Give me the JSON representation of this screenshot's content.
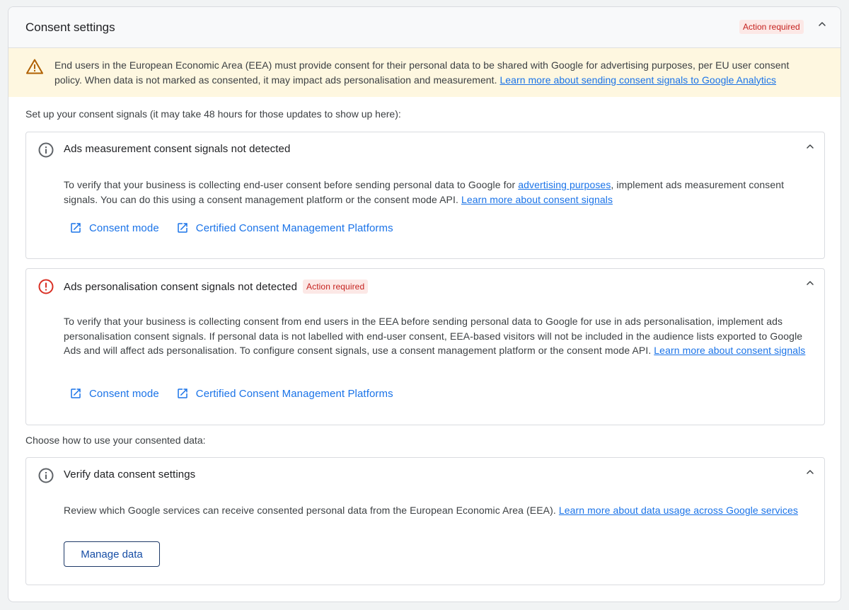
{
  "card": {
    "title": "Consent settings",
    "status_badge": "Action required"
  },
  "warning": {
    "text": "End users in the European Economic Area (EEA) must provide consent for their personal data to be shared with Google for advertising purposes, per EU user consent policy. When data is not marked as consented, it may impact ads personalisation and measurement. ",
    "link": "Learn more about sending consent signals to Google Analytics"
  },
  "setup_label": "Set up your consent signals (it may take 48 hours for those updates to show up here):",
  "measurement_panel": {
    "title": "Ads measurement consent signals not detected",
    "body_1": "To verify that your business is collecting end-user consent before sending personal data to Google for ",
    "body_link_1": "advertising purposes",
    "body_2": ", implement ads measurement consent signals. You can do this using a consent management platform or the consent mode API. ",
    "body_link_2": "Learn more about consent signals",
    "link_consent_mode": "Consent mode",
    "link_cmp": "Certified Consent Management Platforms"
  },
  "personalisation_panel": {
    "title": "Ads personalisation consent signals not detected",
    "badge": "Action required",
    "body": "To verify that your business is collecting consent from end users in the EEA before sending personal data to Google for use in ads personalisation, implement ads personalisation consent signals. If personal data is not labelled with end-user consent, EEA-based visitors will not be included in the audience lists exported to Google Ads and will affect ads personalisation. To configure consent signals, use a consent management platform or the consent mode API. ",
    "body_link": "Learn more about consent signals",
    "link_consent_mode": "Consent mode",
    "link_cmp": "Certified Consent Management Platforms"
  },
  "choose_label": "Choose how to use your consented data:",
  "verify_panel": {
    "title": "Verify data consent settings",
    "body": "Review which Google services can receive consented personal data from the European Economic Area (EEA). ",
    "body_link": "Learn more about data usage across Google services",
    "button": "Manage data"
  },
  "colors": {
    "link": "#1a73e8",
    "warning_bg": "#fef7e0",
    "badge_bg": "#fce8e6",
    "badge_text": "#c5221f",
    "error_icon": "#d93025",
    "warning_icon": "#b06000"
  },
  "icons": {
    "warning": "warning-triangle-icon",
    "info": "info-icon",
    "error": "error-icon",
    "collapse": "chevron-up-icon",
    "external": "open-in-new-icon"
  }
}
